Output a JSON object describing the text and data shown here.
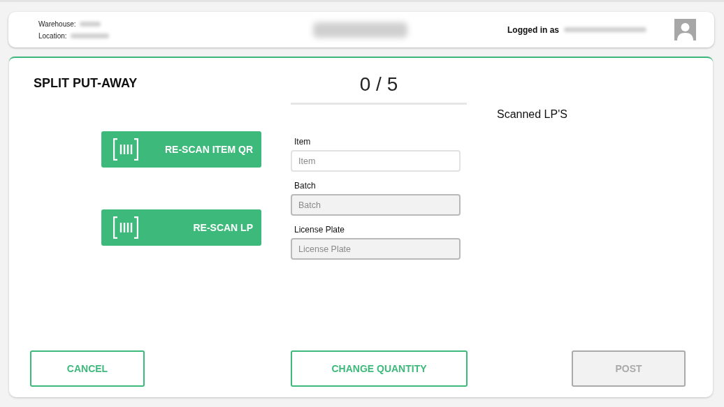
{
  "header": {
    "warehouse_label": "Warehouse:",
    "location_label": "Location:",
    "user_label": "Logged in as"
  },
  "page": {
    "title": "SPLIT PUT-AWAY",
    "counter": "0 / 5",
    "scanned_title": "Scanned LP'S"
  },
  "scan_buttons": [
    {
      "label": "RE-SCAN ITEM QR"
    },
    {
      "label": "RE-SCAN LP"
    }
  ],
  "fields": [
    {
      "label": "Item",
      "placeholder": "Item",
      "disabled": false
    },
    {
      "label": "Batch",
      "placeholder": "Batch",
      "disabled": true
    },
    {
      "label": "License Plate",
      "placeholder": "License Plate",
      "disabled": true
    }
  ],
  "actions": [
    {
      "label": "CANCEL",
      "disabled": false
    },
    {
      "label": "CHANGE QUANTITY",
      "disabled": false
    },
    {
      "label": "POST",
      "disabled": true
    }
  ]
}
